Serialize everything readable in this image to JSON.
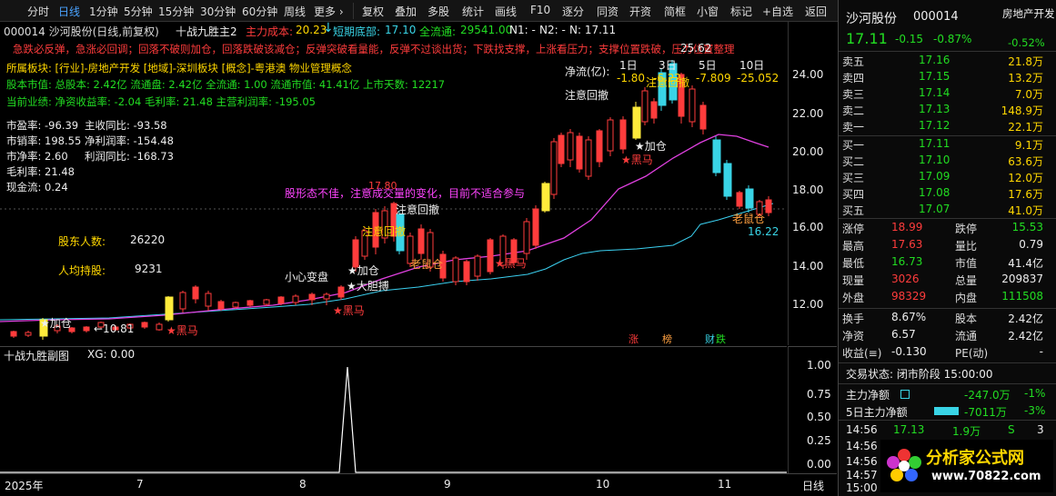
{
  "toolbar": {
    "items": [
      "分时",
      "日线",
      "1分钟",
      "5分钟",
      "15分钟",
      "30分钟",
      "60分钟",
      "周线",
      "更多 ›",
      "复权",
      "叠加",
      "多股",
      "统计",
      "画线",
      "F10",
      "逐分",
      "同资",
      "开资",
      "简框",
      "小窗",
      "标记",
      "+自选",
      "返回"
    ]
  },
  "main": {
    "title_code": "000014 沙河股份(日线,前复权)",
    "indicator": "十战九胜主2",
    "main_cost_label": "主力成本:",
    "main_cost": "20.23",
    "short_bottom_label": "短期底部:",
    "short_bottom": "17.10",
    "circ_label": "全流通:",
    "circ": "29541.00",
    "n1": "N1: -",
    "n2": "N2: -",
    "n": "N: 17.11",
    "warning": "急跌必反弹，急涨必回调；回落不破则加仓，回落跌破该减仓；反弹突破看量能，反弹不过谈出货；下跌找支撑，上涨看压力；支撑位置跌破，压力位置整理",
    "sector": "所属板块: [行业]-房地产开发 [地域]-深圳板块 [概念]-粤港澳 物业管理概念",
    "capital": "股本市值: 总股本: 2.42亿 流通盘: 2.42亿 全流通: 1.00 流通市值: 41.41亿 上市天数: 12217",
    "business": "当前业绩: 净资收益率: -2.04 毛利率: 21.48 主营利润率: -195.05",
    "fin": [
      [
        "市盈率: -96.39",
        "主收同比: -93.58"
      ],
      [
        "市销率: 198.55",
        "净利润率: -154.48"
      ],
      [
        "市净率: 2.60",
        "利润同比: -168.73"
      ],
      [
        "毛利率: 21.48",
        ""
      ],
      [
        "现金流: 0.24",
        ""
      ]
    ],
    "holders_label": "股东人数:",
    "holders": "26220",
    "per_holder_label": "人均持股:",
    "per_holder": "9231",
    "netflow_label": "净流(亿):",
    "netflow_cols": [
      "1日",
      "3日",
      "5日",
      "10日"
    ],
    "netflow_vals": [
      "-1.80",
      "-6.22",
      "-7.809",
      "-25.052"
    ],
    "notes": {
      "weak": "股形态不佳，注意成交量的变化，目前不适合参与",
      "attention1": "注意回撤",
      "attention2": "注意回撤",
      "attention3": "注意回撤",
      "attention4": "注意回撤",
      "small_change": "小心变盘",
      "big_buy": "★大胆搏",
      "add1": "★加仓",
      "add2": "★加仓",
      "add3": "★加仓",
      "black1": "★黑马",
      "black2": "★黑马",
      "black3": "★黑马",
      "black4": "★黑马",
      "old_rat1": "老鼠仓",
      "old_rat2": "老鼠仓",
      "p1780": "17.80",
      "p2562": "25.62",
      "p1081": "←10.81",
      "p1622": "16.22"
    },
    "badges": [
      "涨",
      "榜",
      "财",
      "跌"
    ],
    "yticks": [
      "24.00",
      "22.00",
      "20.00",
      "18.00",
      "16.00",
      "14.00",
      "12.00"
    ]
  },
  "sub": {
    "title": "十战九胜副图",
    "xg": "XG: 0.00",
    "yticks": [
      "1.00",
      "0.75",
      "0.50",
      "0.25",
      "0.00"
    ]
  },
  "time": {
    "labels": [
      "2025年",
      "7",
      "8",
      "9",
      "10",
      "11"
    ],
    "period": "日线"
  },
  "panel": {
    "name": "沙河股份",
    "code": "000014",
    "sector_tag": "房地产开发",
    "sector_pct": "-0.52%",
    "price": "17.11",
    "change": "-0.15",
    "pct": "-0.87%",
    "asks": [
      [
        "卖五",
        "17.16",
        "21.8万"
      ],
      [
        "卖四",
        "17.15",
        "13.2万"
      ],
      [
        "卖三",
        "17.14",
        "7.0万"
      ],
      [
        "卖二",
        "17.13",
        "148.9万"
      ],
      [
        "卖一",
        "17.12",
        "22.1万"
      ]
    ],
    "bids": [
      [
        "买一",
        "17.11",
        "9.1万"
      ],
      [
        "买二",
        "17.10",
        "63.6万"
      ],
      [
        "买三",
        "17.09",
        "12.0万"
      ],
      [
        "买四",
        "17.08",
        "17.6万"
      ],
      [
        "买五",
        "17.07",
        "41.0万"
      ]
    ],
    "stats": [
      [
        "涨停",
        "18.99",
        "跌停",
        "15.53"
      ],
      [
        "最高",
        "17.63",
        "量比",
        "0.79"
      ],
      [
        "最低",
        "16.73",
        "市值",
        "41.4亿"
      ],
      [
        "现量",
        "3026",
        "总量",
        "209837"
      ],
      [
        "外盘",
        "98329",
        "内盘",
        "111508"
      ]
    ],
    "stats2": [
      [
        "换手",
        "8.67%",
        "股本",
        "2.42亿"
      ],
      [
        "净资",
        "6.57",
        "流通",
        "2.42亿"
      ],
      [
        "收益(≡)",
        "-0.130",
        "PE(动)",
        "-"
      ]
    ],
    "status": "交易状态: 闭市阶段 15:00:00",
    "flow1_label": "主力净额",
    "flow1": "-247.0万",
    "flow1_pct": "-1%",
    "flow2_label": "5日主力净额",
    "flow2": "-7011万",
    "flow2_pct": "-3%",
    "ticks": [
      [
        "14:56",
        "17.13",
        "1.9万",
        "S",
        "3"
      ],
      [
        "14:56",
        "",
        "",
        "",
        ""
      ],
      [
        "14:56",
        "",
        "",
        "",
        ""
      ],
      [
        "14:57",
        "",
        "",
        "",
        ""
      ],
      [
        "15:00",
        "",
        "",
        "",
        ""
      ]
    ],
    "watermark": "分析家公式网",
    "watermark_url": "www.70822.com"
  }
}
